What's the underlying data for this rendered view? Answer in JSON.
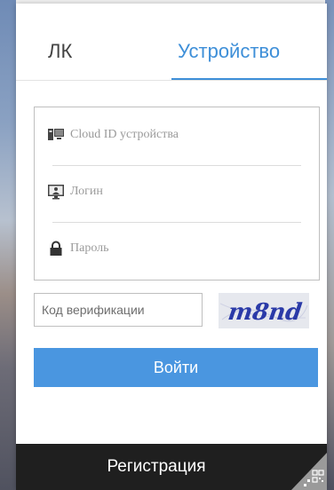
{
  "tabs": [
    {
      "label": "ЛК",
      "active": false
    },
    {
      "label": "Устройство",
      "active": true
    }
  ],
  "form": {
    "cloud_id_placeholder": "Cloud ID устройства",
    "login_placeholder": "Логин",
    "password_placeholder": "Пароль",
    "verification_placeholder": "Код верификации",
    "captcha_text": "m8nd",
    "login_button": "Войти"
  },
  "footer": {
    "register_label": "Регистрация"
  },
  "colors": {
    "accent": "#3e8fd8",
    "button": "#4a96e0",
    "footer": "#1f1f1f",
    "captcha_text": "#2a3aa8"
  }
}
